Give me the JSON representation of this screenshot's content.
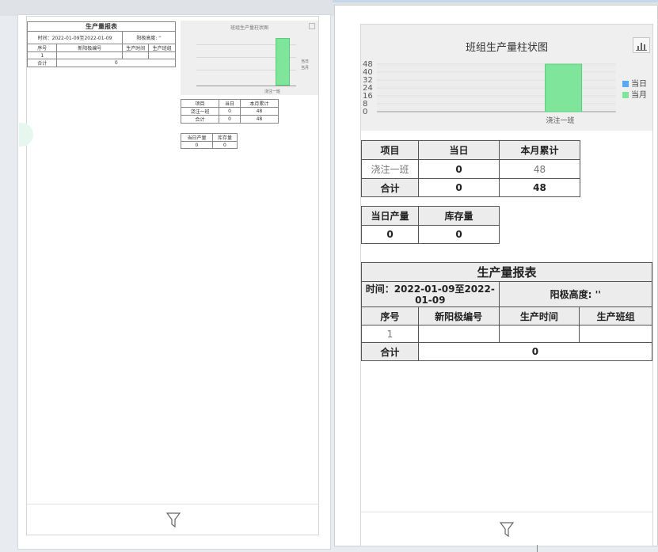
{
  "report": {
    "title": "生产量报表",
    "time_label": "时间：2022-01-09至2022-01-09",
    "anode_label": "阳极高度: ''",
    "columns": [
      "序号",
      "新阳极编号",
      "生产时间",
      "生产班组"
    ],
    "rows": [
      [
        "1",
        "",
        "",
        ""
      ]
    ],
    "total_label": "合计",
    "total_value": "0"
  },
  "chart_data": {
    "type": "bar",
    "title": "班组生产量柱状图",
    "categories": [
      "浇注一班"
    ],
    "series": [
      {
        "name": "当日",
        "values": [
          0
        ],
        "color": "#5aa9f0"
      },
      {
        "name": "当月",
        "values": [
          48
        ],
        "color": "#7fe59a"
      }
    ],
    "yticks": [
      "48",
      "40",
      "32",
      "24",
      "16",
      "8",
      "0"
    ],
    "ylim": [
      0,
      48
    ],
    "legend_position": "right"
  },
  "team_table": {
    "headers": [
      "项目",
      "当日",
      "本月累计"
    ],
    "rows": [
      [
        "浇注一班",
        "0",
        "48"
      ]
    ],
    "total": [
      "合计",
      "0",
      "48"
    ]
  },
  "stock_table": {
    "headers": [
      "当日产量",
      "库存量"
    ],
    "values": [
      "0",
      "0"
    ]
  },
  "mini": {
    "time_label": "时间：2022-01-09至2022-01-09",
    "anode_label": "阳极高度: ''",
    "chart_title": "班组生产量柱状图"
  },
  "icons": {
    "filter": "filter-icon",
    "chart_toggle": "bar-chart-icon"
  }
}
